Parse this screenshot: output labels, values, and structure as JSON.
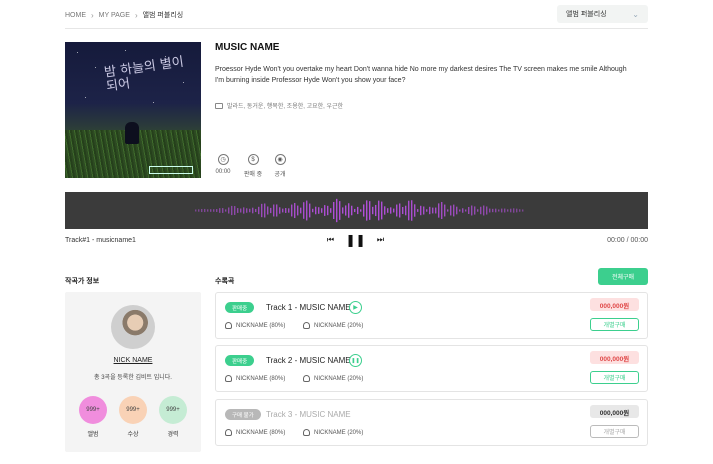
{
  "breadcrumb": {
    "home": "HOME",
    "mypage": "MY PAGE",
    "current": "앨범 퍼블리싱"
  },
  "dropdown": {
    "selected": "앨범 퍼블리싱"
  },
  "album": {
    "cover_text": "밤 하늘의 별이 되어",
    "title": "MUSIC NAME",
    "description": "Proessor Hyde Won't you overtake my heart Don't wanna hide No more my darkest desires The TV screen makes me smile Although I'm burning inside Professor Hyde Won't you show your face?",
    "tags": "발라드, 동거운, 행복한, 조용한, 고요한, 우근한",
    "stats": [
      {
        "icon": "clock-icon",
        "label": "00:00"
      },
      {
        "icon": "dollar-icon",
        "label": "판매 중"
      },
      {
        "icon": "eye-icon",
        "label": "공개"
      }
    ]
  },
  "player": {
    "track_label": "Track#1 - musicname1",
    "time": "00:00 / 00:00",
    "wave_color": "#b04fd8"
  },
  "composer": {
    "section_title": "작곡가 정보",
    "nickname": "NICK NAME",
    "subtitle": "총 3곡을 등록한 김비트 입니다.",
    "stats": [
      {
        "value": "999+",
        "label": "앨범",
        "color": "#f08ddd"
      },
      {
        "value": "999+",
        "label": "수상",
        "color": "#f9d2b6"
      },
      {
        "value": "999+",
        "label": "경력",
        "color": "#c5ecd4"
      }
    ]
  },
  "tracks_section": {
    "title": "수록곡",
    "buy_all": "전체구매",
    "tracks": [
      {
        "badge": "판매중",
        "name": "Track 1 - MUSIC NAME",
        "credit1": "NICKNAME (80%)",
        "credit2": "NICKNAME (20%)",
        "price": "000,000원",
        "buy": "개별구매",
        "active": true,
        "play": "▶"
      },
      {
        "badge": "판매중",
        "name": "Track 2 - MUSIC NAME",
        "credit1": "NICKNAME (80%)",
        "credit2": "NICKNAME (20%)",
        "price": "000,000원",
        "buy": "개별구매",
        "active": true,
        "play": "❚❚"
      },
      {
        "badge": "구매 불가",
        "name": "Track 3 - MUSIC NAME",
        "credit1": "NICKNAME (80%)",
        "credit2": "NICKNAME (20%)",
        "price": "000,000원",
        "buy": "개별구매",
        "active": false,
        "play": ""
      }
    ]
  }
}
